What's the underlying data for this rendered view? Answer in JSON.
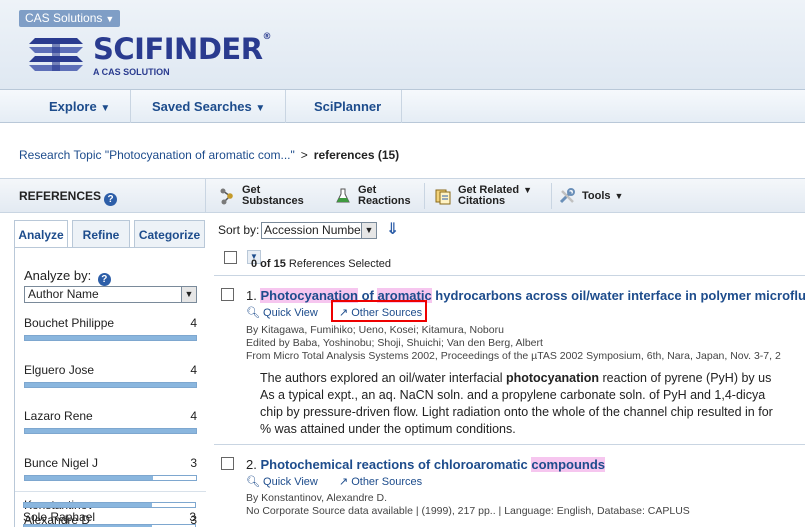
{
  "header": {
    "cas_tab": "CAS Solutions",
    "logo_text": "SCIFINDER",
    "logo_reg": "®",
    "logo_sub": "A CAS SOLUTION"
  },
  "nav": {
    "explore": "Explore",
    "saved_searches": "Saved Searches",
    "sciplanner": "SciPlanner"
  },
  "breadcrumb": {
    "link": "Research Topic \"Photocyanation of aromatic com...\"",
    "separator": ">",
    "current": "references (15)"
  },
  "left": {
    "title": "REFERENCES",
    "tabs": [
      "Analyze",
      "Refine",
      "Categorize"
    ],
    "analyze_by_label": "Analyze by:",
    "analyze_by_value": "Author Name",
    "authors": [
      {
        "name": "Bouchet Philippe",
        "count": "4",
        "fraction": 1.0
      },
      {
        "name": "Elguero Jose",
        "count": "4",
        "fraction": 1.0
      },
      {
        "name": "Lazaro Rene",
        "count": "4",
        "fraction": 1.0
      },
      {
        "name": "Bunce Nigel J",
        "count": "3",
        "fraction": 0.75
      },
      {
        "name": "Konstantinov",
        "name2": "Alexandre D",
        "count": "3",
        "fraction": 0.75
      },
      {
        "name": "Sole Raphael",
        "count": "3",
        "fraction": 0.75
      }
    ]
  },
  "toolbar": {
    "get_substances_1": "Get",
    "get_substances_2": "Substances",
    "get_reactions_1": "Get",
    "get_reactions_2": "Reactions",
    "get_related_1": "Get Related",
    "get_related_2": "Citations",
    "tools": "Tools"
  },
  "sort": {
    "label": "Sort by:",
    "value": "Accession Number"
  },
  "selection": {
    "count_text": "0 of 15",
    "suffix": "References Selected"
  },
  "results": [
    {
      "number": "1.",
      "title_pre": "",
      "title_hl1": "Photocyanation",
      "title_mid": " of ",
      "title_hl2": "aromatic",
      "title_post": " hydrocarbons across oil/water interface in polymer microfluidic",
      "quick_view": "Quick View",
      "other_sources": "Other Sources",
      "authors": "By Kitagawa, Fumihiko; Ueno, Kosei; Kitamura, Noboru",
      "edited": "Edited by Baba, Yoshinobu; Shoji, Shuichi; Van den Berg, Albert",
      "source": "From Micro Total Analysis Systems 2002, Proceedings of the µTAS 2002 Symposium, 6th, Nara, Japan, Nov. 3-7, 2",
      "abstract_1_pre": "The authors explored an oil/water interfacial ",
      "abstract_1_bold": "photocyanation",
      "abstract_1_post": " reaction of pyrene (PyH) by us",
      "abstract_2": "As a typical expt., an aq. NaCN soln. and a propylene carbonate soln. of PyH and 1,4-dicya",
      "abstract_3": "chip by pressure-driven flow.  Light radiation onto the whole of the channel chip resulted in for",
      "abstract_4": "% was attained under the optimum conditions."
    },
    {
      "number": "2.",
      "title_pre": "Photochemical reactions of chloroaromatic ",
      "title_hl": "compounds",
      "quick_view": "Quick View",
      "other_sources": "Other Sources",
      "authors": "By Konstantinov, Alexandre D.",
      "source": "No Corporate Source data available | (1999), 217 pp.. | Language: English, Database: CAPLUS"
    }
  ]
}
